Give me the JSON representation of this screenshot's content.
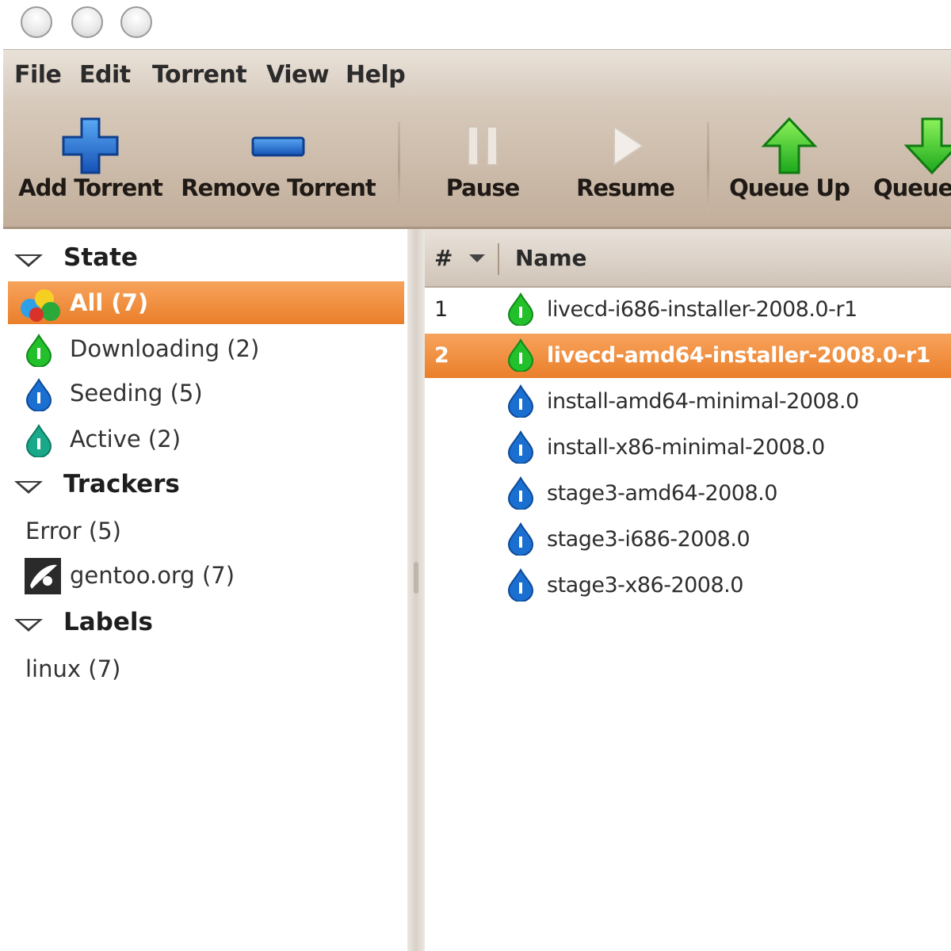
{
  "menubar": {
    "items": [
      "File",
      "Edit",
      "Torrent",
      "View",
      "Help"
    ]
  },
  "toolbar": {
    "add_label": "Add Torrent",
    "remove_label": "Remove Torrent",
    "pause_label": "Pause",
    "resume_label": "Resume",
    "queue_up_label": "Queue Up",
    "queue_down_label": "Queue"
  },
  "sidebar": {
    "state_header": "State",
    "state_items": [
      {
        "label": "All (7)",
        "icon": "all-icon",
        "selected": true
      },
      {
        "label": "Downloading (2)",
        "icon": "downloading-icon"
      },
      {
        "label": "Seeding (5)",
        "icon": "seeding-icon"
      },
      {
        "label": "Active (2)",
        "icon": "active-icon"
      }
    ],
    "trackers_header": "Trackers",
    "tracker_items": [
      {
        "label": "Error (5)"
      },
      {
        "label": "gentoo.org (7)",
        "icon": "gentoo-icon"
      }
    ],
    "labels_header": "Labels",
    "label_items": [
      {
        "label": "linux (7)"
      }
    ]
  },
  "table": {
    "columns": [
      "#",
      "Name"
    ],
    "rows": [
      {
        "num": "1",
        "name": "livecd-i686-installer-2008.0-r1",
        "status": "downloading"
      },
      {
        "num": "2",
        "name": "livecd-amd64-installer-2008.0-r1",
        "status": "downloading",
        "selected": true
      },
      {
        "num": "",
        "name": "install-amd64-minimal-2008.0",
        "status": "seeding"
      },
      {
        "num": "",
        "name": "install-x86-minimal-2008.0",
        "status": "seeding"
      },
      {
        "num": "",
        "name": "stage3-amd64-2008.0",
        "status": "seeding"
      },
      {
        "num": "",
        "name": "stage3-i686-2008.0",
        "status": "seeding"
      },
      {
        "num": "",
        "name": "stage3-x86-2008.0",
        "status": "seeding"
      }
    ]
  },
  "colors": {
    "selection": "#ea7f2a",
    "downloading": "#22c02a",
    "seeding": "#1a6fd0",
    "toolbar": "#cdbcab"
  }
}
